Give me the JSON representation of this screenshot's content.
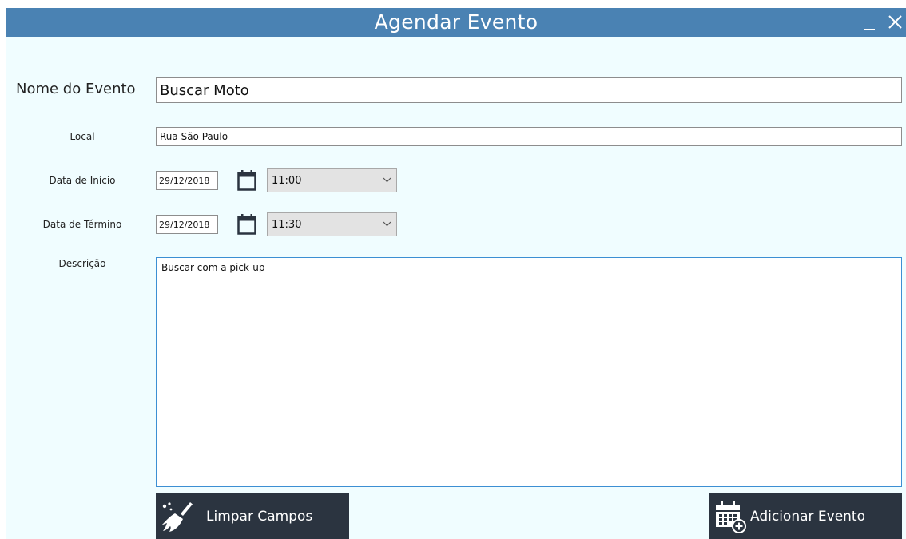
{
  "window": {
    "title": "Agendar Evento"
  },
  "form": {
    "nome_label": "Nome do Evento",
    "nome_value": "Buscar Moto",
    "local_label": "Local",
    "local_value": "Rua São Paulo",
    "inicio_label": "Data de Início",
    "inicio_date": "29/12/2018",
    "inicio_time": "11:00",
    "termino_label": "Data de Término",
    "termino_date": "29/12/2018",
    "termino_time": "11:30",
    "descricao_label": "Descrição",
    "descricao_value": "Buscar com a pick-up"
  },
  "buttons": {
    "limpar": "Limpar Campos",
    "adicionar": "Adicionar Evento"
  },
  "icons": {
    "minimize": "minimize-icon",
    "close": "close-icon",
    "calendar": "calendar-icon",
    "dropdown": "chevron-down-icon",
    "broom": "broom-icon",
    "calendar_add": "calendar-add-icon"
  },
  "colors": {
    "titlebar": "#4a82b3",
    "background": "#f0fdff",
    "button": "#2b3440",
    "textarea_border": "#3c8fd3"
  }
}
